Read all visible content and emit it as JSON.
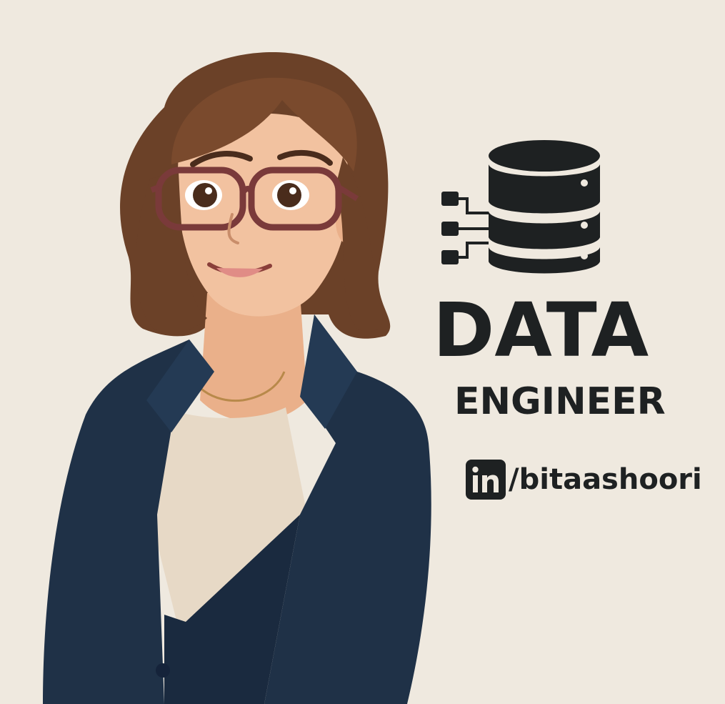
{
  "title_line1": "DATA",
  "title_line2": "ENGINEER",
  "social": {
    "icon": "linkedin-icon",
    "handle": "/bitaashoori"
  },
  "colors": {
    "background": "#efe9df",
    "text": "#1e2122",
    "blazer": "#1f3147",
    "hair": "#6b4128",
    "skin": "#f2c2a0",
    "glasses": "#7a3a3a"
  },
  "icons": [
    "database-server-icon",
    "linkedin-icon"
  ]
}
